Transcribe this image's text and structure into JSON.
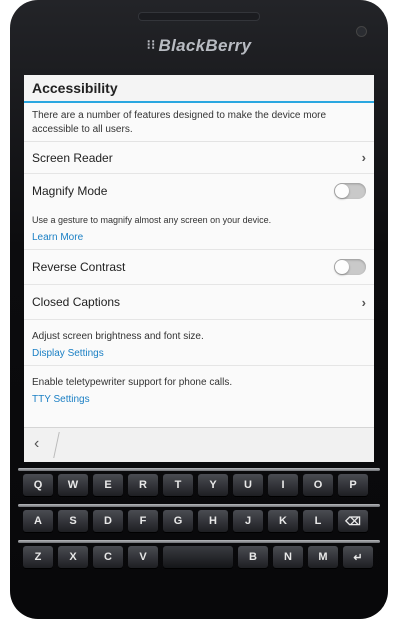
{
  "device": {
    "brand": "BlackBerry",
    "brand_mark": "⁝⁝"
  },
  "screen": {
    "title": "Accessibility",
    "intro": "There are a number of features designed to make the device more accessible to all users.",
    "items": {
      "screen_reader": "Screen Reader",
      "magnify_mode": "Magnify Mode",
      "magnify_desc": "Use a gesture to magnify almost any screen on your device.",
      "magnify_link": "Learn More",
      "reverse_contrast": "Reverse Contrast",
      "closed_captions": "Closed Captions",
      "display_desc": "Adjust screen brightness and font size.",
      "display_link": "Display Settings",
      "tty_desc": "Enable teletypewriter support for phone calls.",
      "tty_link": "TTY Settings"
    },
    "toggles": {
      "magnify_mode_on": false,
      "reverse_contrast_on": false
    },
    "chevron": "›",
    "back_glyph": "‹"
  },
  "keyboard": {
    "row1": [
      "Q",
      "W",
      "E",
      "R",
      "T",
      "Y",
      "U",
      "I",
      "O",
      "P"
    ],
    "row2": [
      "A",
      "S",
      "D",
      "F",
      "G",
      "H",
      "J",
      "K",
      "L",
      "⌫"
    ],
    "row3": [
      "Z",
      "X",
      "C",
      "V",
      "B",
      "N",
      "M",
      "↵"
    ]
  },
  "colors": {
    "accent": "#2aa7e0",
    "link": "#1a7fc4"
  }
}
